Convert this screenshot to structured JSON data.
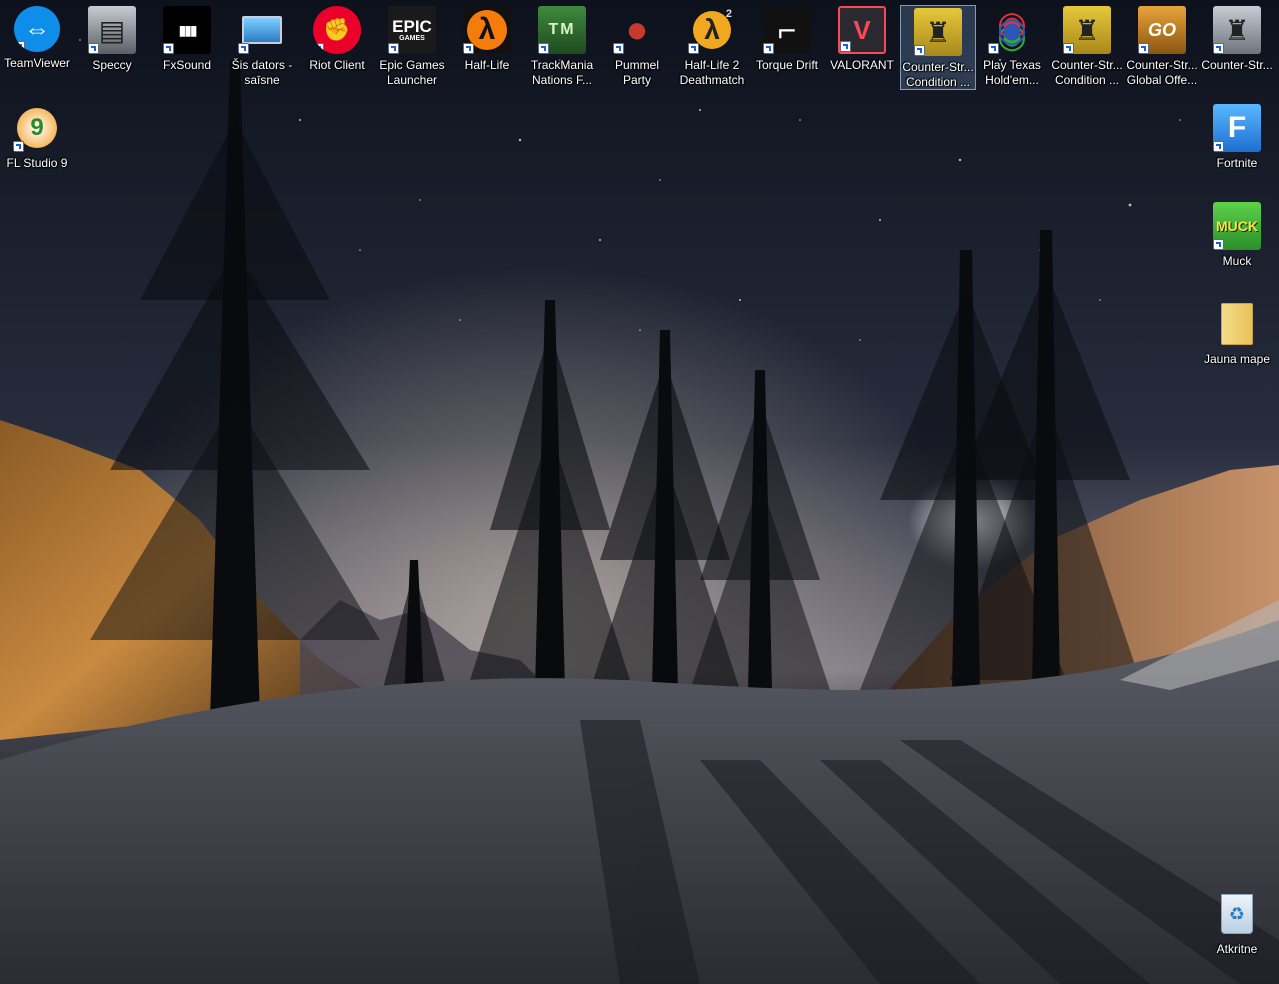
{
  "desktop": {
    "icons": [
      {
        "label": "TeamViewer",
        "icon": "teamviewer-icon",
        "color": "#0e8ee9"
      },
      {
        "label": "Speccy",
        "icon": "speccy-icon",
        "color": "#5a5f66"
      },
      {
        "label": "FxSound",
        "icon": "fxsound-icon",
        "color": "#000000"
      },
      {
        "label": "Šis dators - saīsne",
        "icon": "computer-icon",
        "color": "#3a9ad9"
      },
      {
        "label": "Riot Client",
        "icon": "riot-client-icon",
        "color": "#eb0029"
      },
      {
        "label": "Epic Games Launcher",
        "icon": "epic-games-icon",
        "color": "#1a1a1a"
      },
      {
        "label": "Half-Life",
        "icon": "half-life-icon",
        "color": "#f57b0a"
      },
      {
        "label": "TrackMania Nations F...",
        "icon": "trackmania-icon",
        "color": "#2f6b2f"
      },
      {
        "label": "Pummel Party",
        "icon": "pummel-party-icon",
        "color": "#c93a2e"
      },
      {
        "label": "Half-Life 2 Deathmatch",
        "icon": "half-life-2-icon",
        "color": "#f0a81e"
      },
      {
        "label": "Torque Drift",
        "icon": "torque-drift-icon",
        "color": "#111111"
      },
      {
        "label": "VALORANT",
        "icon": "valorant-icon",
        "color": "#ff4655"
      },
      {
        "label": "Counter-Str... Condition ...",
        "icon": "counter-strike-cz-icon",
        "color": "#d7b42b"
      },
      {
        "label": "Play Texas Hold'em...",
        "icon": "poker-chips-icon",
        "color": "#2c55b8"
      },
      {
        "label": "Counter-Str... Condition ...",
        "icon": "counter-strike-cz-icon",
        "color": "#d7b42b"
      },
      {
        "label": "Counter-Str... Global Offe...",
        "icon": "csgo-icon",
        "color": "#d88b1e"
      },
      {
        "label": "Counter-Str...",
        "icon": "counter-strike-icon",
        "color": "#9aa3ad"
      },
      {
        "label": "FL Studio 9",
        "icon": "fl-studio-icon",
        "color": "#f39a1c"
      },
      {
        "label": "Fortnite",
        "icon": "fortnite-icon",
        "color": "#1e8ff0"
      },
      {
        "label": "Muck",
        "icon": "muck-icon",
        "color": "#37c12e"
      },
      {
        "label": "Jauna mape",
        "icon": "folder-icon",
        "color": "#f1d27a"
      },
      {
        "label": "Atkritne",
        "icon": "recycle-bin-icon",
        "color": "#cfe3f5"
      }
    ],
    "glyphs": {
      "speccy": "▤",
      "fxsound": "▮▮▮",
      "computer": "▭",
      "riot": "✊",
      "epic": "EPIC",
      "epic_sub": "GAMES",
      "half_life": "λ",
      "trackmania": "TM",
      "pummel": "●",
      "hl2": "λ",
      "hl2_sup": "2",
      "torque": "⌐",
      "valorant": "V",
      "cs": "♜",
      "poker": "◉",
      "csgo": "GO",
      "fl": "9",
      "fortnite": "F",
      "muck": "MUCK",
      "folder": "▭",
      "recycle": "♻"
    }
  }
}
